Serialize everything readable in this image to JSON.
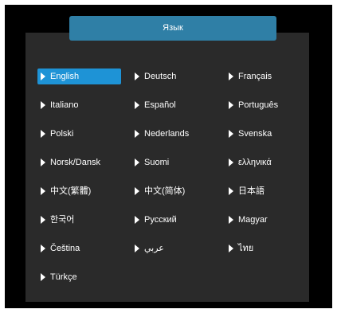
{
  "header": {
    "title": "Язык"
  },
  "languages": [
    {
      "label": "English",
      "selected": true
    },
    {
      "label": "Deutsch",
      "selected": false
    },
    {
      "label": "Français",
      "selected": false
    },
    {
      "label": "Italiano",
      "selected": false
    },
    {
      "label": "Español",
      "selected": false
    },
    {
      "label": "Português",
      "selected": false
    },
    {
      "label": "Polski",
      "selected": false
    },
    {
      "label": "Nederlands",
      "selected": false
    },
    {
      "label": "Svenska",
      "selected": false
    },
    {
      "label": "Norsk/Dansk",
      "selected": false
    },
    {
      "label": "Suomi",
      "selected": false
    },
    {
      "label": "ελληνικά",
      "selected": false
    },
    {
      "label": "中文(繁體)",
      "selected": false
    },
    {
      "label": "中文(简体)",
      "selected": false
    },
    {
      "label": "日本語",
      "selected": false
    },
    {
      "label": "한국어",
      "selected": false
    },
    {
      "label": "Русский",
      "selected": false
    },
    {
      "label": "Magyar",
      "selected": false
    },
    {
      "label": "Čeština",
      "selected": false
    },
    {
      "label": "عربي",
      "selected": false
    },
    {
      "label": "ไทย",
      "selected": false
    },
    {
      "label": "Türkçe",
      "selected": false
    }
  ],
  "colors": {
    "background": "#000000",
    "panel": "#2a2a2a",
    "title_tab": "#2f7fa6",
    "selected_highlight": "#1e93d6",
    "text": "#ffffff"
  }
}
